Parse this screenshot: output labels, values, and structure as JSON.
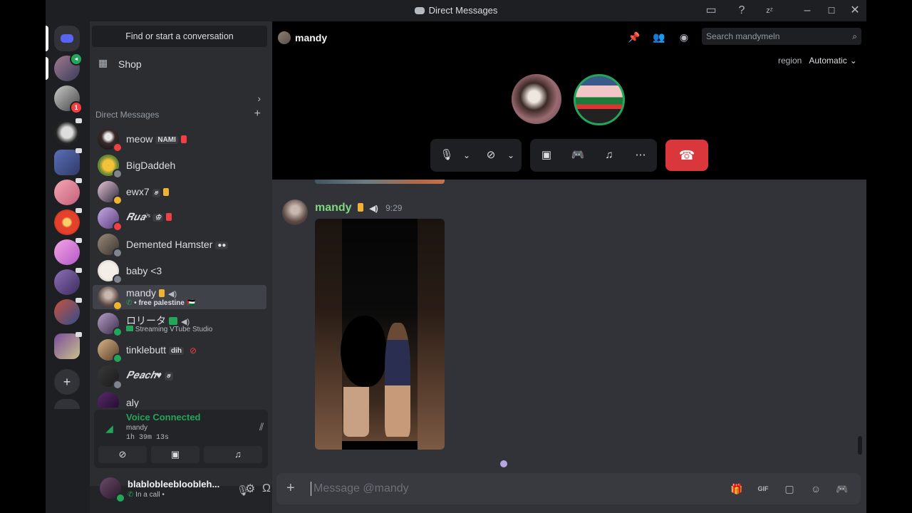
{
  "window": {
    "title": "Direct Messages"
  },
  "dm_list": {
    "find_label": "Find or start a conversation",
    "shop_label": "Shop",
    "section_title": "Direct Messages",
    "items": [
      {
        "name": "meow",
        "tag": "NAMI",
        "subtext": ""
      },
      {
        "name": "BigDaddeh",
        "tag": "",
        "subtext": ""
      },
      {
        "name": "ewx7",
        "tag": "ச",
        "subtext": ""
      },
      {
        "name": "𝑹𝒖𝒂ˀˢ",
        "tag": "♔",
        "subtext": ""
      },
      {
        "name": "Demented Hamster",
        "tag": "●●",
        "subtext": ""
      },
      {
        "name": "baby <3",
        "tag": "",
        "subtext": ""
      },
      {
        "name": "mandy",
        "tag": "",
        "subtext": "• free palestine 🇵🇸"
      },
      {
        "name": "ロリータ",
        "tag": "",
        "subtext": "Streaming VTube Studio"
      },
      {
        "name": "tinklebutt",
        "tag": "dih",
        "subtext": ""
      },
      {
        "name": "𝑷𝒆𝒂𝒄𝒉♥",
        "tag": "ச",
        "subtext": ""
      },
      {
        "name": "aly",
        "tag": "",
        "subtext": ""
      }
    ]
  },
  "voice_panel": {
    "status": "Voice Connected",
    "channel": "mandy",
    "duration": "1h 39m 13s"
  },
  "user_panel": {
    "username": "blablobleebloobleh...",
    "status": "In a call •"
  },
  "header": {
    "channel_name": "mandy",
    "search_placeholder": "Search mandymeln",
    "region_label": "region",
    "region_value": "Automatic"
  },
  "message": {
    "author": "mandy",
    "time": "9:29"
  },
  "composer": {
    "placeholder": "Message @mandy"
  },
  "colors": {
    "accent_green": "#23a55a",
    "danger_red": "#da373c",
    "author_green": "#7ed880"
  }
}
